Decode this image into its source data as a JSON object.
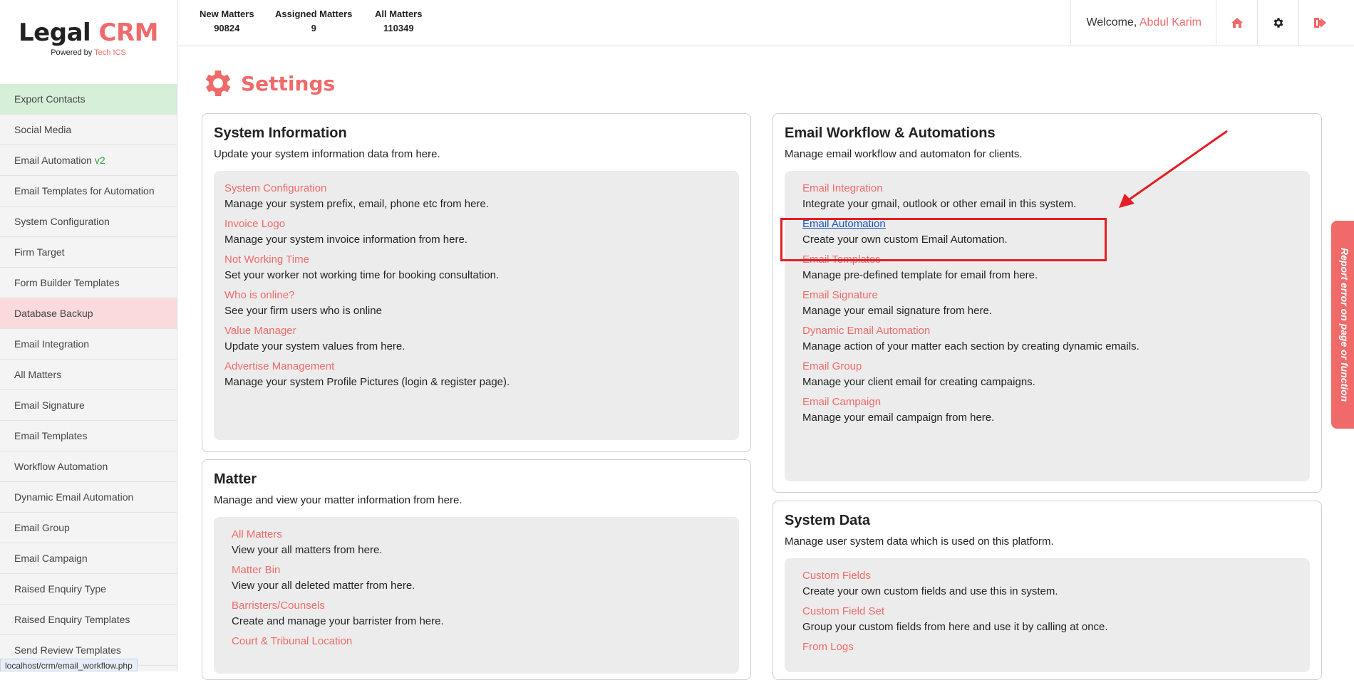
{
  "brand": {
    "title_a": "Legal",
    "title_b": "CRM",
    "powered_by": "Powered by",
    "powered_name": "Tech ICS"
  },
  "sidebar": {
    "items": [
      {
        "label": "Export Contacts",
        "style": "green"
      },
      {
        "label": "Social Media"
      },
      {
        "label": "Email Automation",
        "suffix": "v2"
      },
      {
        "label": "Email Templates for Automation"
      },
      {
        "label": "System Configuration"
      },
      {
        "label": "Firm Target"
      },
      {
        "label": "Form Builder Templates"
      },
      {
        "label": "Database Backup",
        "style": "pink"
      },
      {
        "label": "Email Integration"
      },
      {
        "label": "All Matters"
      },
      {
        "label": "Email Signature"
      },
      {
        "label": "Email Templates"
      },
      {
        "label": "Workflow Automation"
      },
      {
        "label": "Dynamic Email Automation"
      },
      {
        "label": "Email Group"
      },
      {
        "label": "Email Campaign"
      },
      {
        "label": "Raised Enquiry Type"
      },
      {
        "label": "Raised Enquiry Templates"
      },
      {
        "label": "Send Review Templates"
      }
    ]
  },
  "topbar": {
    "stats": [
      {
        "label": "New Matters",
        "value": "90824"
      },
      {
        "label": "Assigned Matters",
        "value": "9"
      },
      {
        "label": "All Matters",
        "value": "110349"
      }
    ],
    "welcome": "Welcome,",
    "user": "Abdul Karim",
    "icons": [
      "home-icon",
      "gear-icon",
      "logout-icon"
    ]
  },
  "page": {
    "title": "Settings"
  },
  "cards": {
    "system_info": {
      "title": "System Information",
      "desc": "Update your system information data from here.",
      "entries": [
        {
          "link": "System Configuration",
          "desc": "Manage your system prefix, email, phone etc from here."
        },
        {
          "link": "Invoice Logo",
          "desc": "Manage your system invoice information from here."
        },
        {
          "link": "Not Working Time",
          "desc": "Set your worker not working time for booking consultation."
        },
        {
          "link": "Who is online?",
          "desc": "See your firm users who is online"
        },
        {
          "link": "Value Manager",
          "desc": "Update your system values from here."
        },
        {
          "link": "Advertise Management",
          "desc": "Manage your system Profile Pictures (login & register page)."
        }
      ]
    },
    "matter": {
      "title": "Matter",
      "desc": "Manage and view your matter information from here.",
      "entries": [
        {
          "link": "All Matters",
          "desc": "View your all matters from here."
        },
        {
          "link": "Matter Bin",
          "desc": "View your all deleted matter from here."
        },
        {
          "link": "Barristers/Counsels",
          "desc": "Create and manage your barrister from here."
        },
        {
          "link": "Court & Tribunal Location",
          "desc": ""
        }
      ]
    },
    "email_workflow": {
      "title": "Email Workflow & Automations",
      "desc": "Manage email workflow and automaton for clients.",
      "entries": [
        {
          "link": "Email Integration",
          "desc": "Integrate your gmail, outlook or other email in this system."
        },
        {
          "link": "Email Automation",
          "desc": "Create your own custom Email Automation.",
          "active": true
        },
        {
          "link": "Email Templates",
          "desc": "Manage pre-defined template for email from here."
        },
        {
          "link": "Email Signature",
          "desc": "Manage your email signature from here."
        },
        {
          "link": "Dynamic Email Automation",
          "desc": "Manage action of your matter each section by creating dynamic emails."
        },
        {
          "link": "Email Group",
          "desc": "Manage your client email for creating campaigns."
        },
        {
          "link": "Email Campaign",
          "desc": "Manage your email campaign from here."
        }
      ]
    },
    "system_data": {
      "title": "System Data",
      "desc": "Manage user system data which is used on this platform.",
      "entries": [
        {
          "link": "Custom Fields",
          "desc": "Create your own custom fields and use this in system."
        },
        {
          "link": "Custom Field Set",
          "desc": "Group your custom fields from here and use it by calling at once."
        },
        {
          "link": "From Logs",
          "desc": ""
        }
      ]
    }
  },
  "report_tab": "Report error on page or function",
  "status_url": "localhost/crm/email_workflow.php",
  "colors": {
    "accent": "#f06a6a",
    "highlight": "#e31e24",
    "link_active": "#1a55b8"
  }
}
